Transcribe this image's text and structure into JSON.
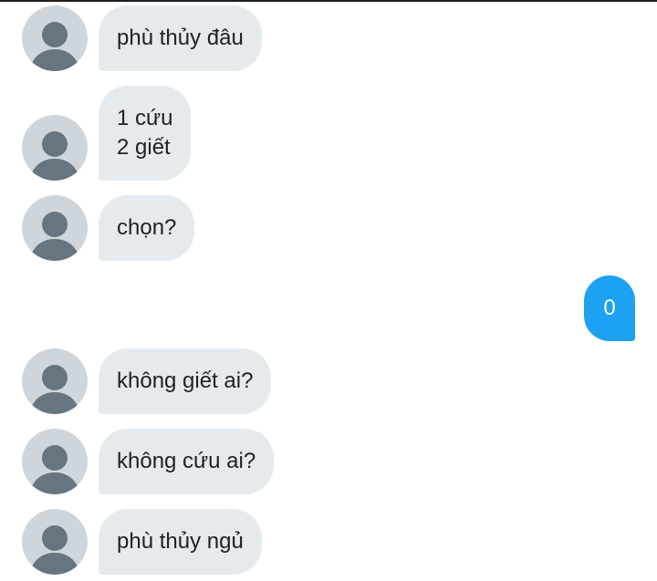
{
  "conversation": {
    "messages": [
      {
        "direction": "incoming",
        "text": "phù thủy đâu",
        "avatar_icon": "default-user-avatar-icon"
      },
      {
        "direction": "incoming",
        "text": "1 cứu\n2 giết",
        "avatar_icon": "default-user-avatar-icon"
      },
      {
        "direction": "incoming",
        "text": "chọn?",
        "avatar_icon": "default-user-avatar-icon"
      },
      {
        "direction": "outgoing",
        "text": "0"
      },
      {
        "direction": "incoming",
        "text": "không giết ai?",
        "avatar_icon": "default-user-avatar-icon"
      },
      {
        "direction": "incoming",
        "text": "không cứu ai?",
        "avatar_icon": "default-user-avatar-icon"
      },
      {
        "direction": "incoming",
        "text": "phù thủy ngủ",
        "avatar_icon": "default-user-avatar-icon"
      }
    ]
  },
  "colors": {
    "incoming_bubble": "#e5eaee",
    "outgoing_bubble": "#1da1f2",
    "avatar_background": "#cfd6db",
    "avatar_figure": "#66757f",
    "text_dark": "#1b2126"
  }
}
